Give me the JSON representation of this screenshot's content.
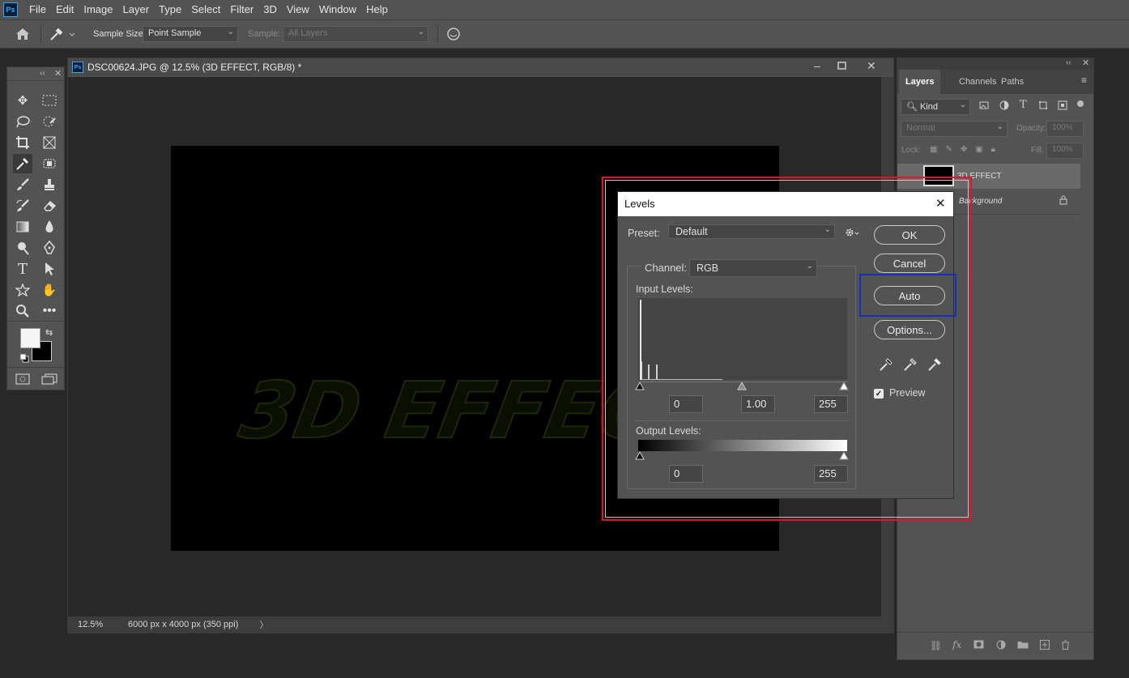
{
  "app": {
    "logo": "Ps"
  },
  "menu": [
    "File",
    "Edit",
    "Image",
    "Layer",
    "Type",
    "Select",
    "Filter",
    "3D",
    "View",
    "Window",
    "Help"
  ],
  "options_bar": {
    "sample_size_label": "Sample Size:",
    "sample_size_value": "Point Sample",
    "sample_label": "Sample:",
    "sample_value": "All Layers"
  },
  "document": {
    "title": "DSC00624.JPG @ 12.5% (3D EFFECT, RGB/8) *",
    "zoom": "12.5%",
    "dimensions": "6000 px x 4000 px (350 ppi)",
    "canvas_text": "3D EFFECT"
  },
  "layers_panel": {
    "tabs": [
      "Layers",
      "Channels",
      "Paths"
    ],
    "filter_kind": "Kind",
    "blend_mode": "Normal",
    "opacity_label": "Opacity:",
    "opacity_value": "100%",
    "lock_label": "Lock:",
    "fill_label": "Fill:",
    "fill_value": "100%",
    "layers": [
      {
        "name": "3D EFFECT"
      },
      {
        "name": "Background"
      }
    ]
  },
  "levels_dialog": {
    "title": "Levels",
    "preset_label": "Preset:",
    "preset_value": "Default",
    "channel_label": "Channel:",
    "channel_value": "RGB",
    "input_levels_label": "Input Levels:",
    "input_black": "0",
    "input_gamma": "1.00",
    "input_white": "255",
    "output_levels_label": "Output Levels:",
    "output_black": "0",
    "output_white": "255",
    "buttons": {
      "ok": "OK",
      "cancel": "Cancel",
      "auto": "Auto",
      "options": "Options..."
    },
    "preview_label": "Preview",
    "preview_checked": true
  },
  "colors": {
    "highlight_red": "#e0142a",
    "highlight_blue": "#1a2dbd",
    "accent": "#31a8ff"
  }
}
